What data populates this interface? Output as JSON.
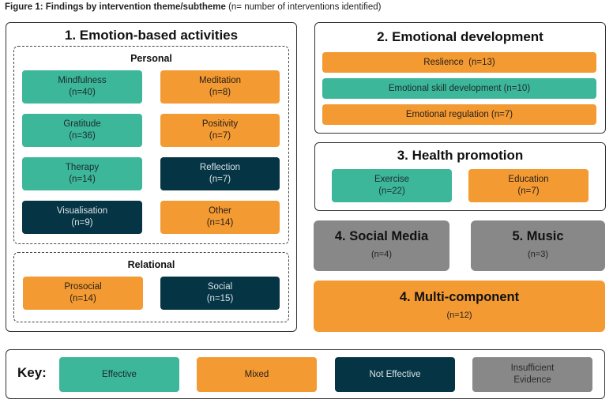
{
  "caption": {
    "bold": "Figure 1: Findings by intervention theme/subtheme",
    "normal": " (n= number of interventions identified)"
  },
  "colors": {
    "effective": "#3cb79a",
    "mixed": "#f39a33",
    "not_effective": "#053444",
    "insufficient": "#888888"
  },
  "theme1": {
    "title": "1. Emotion-based activities",
    "personal": {
      "title": "Personal",
      "items": [
        {
          "label": "Mindfulness",
          "n": "(n=40)",
          "status": "effective"
        },
        {
          "label": "Meditation",
          "n": "(n=8)",
          "status": "mixed"
        },
        {
          "label": "Gratitude",
          "n": "(n=36)",
          "status": "effective"
        },
        {
          "label": "Positivity",
          "n": "(n=7)",
          "status": "mixed"
        },
        {
          "label": "Therapy",
          "n": "(n=14)",
          "status": "effective"
        },
        {
          "label": "Reflection",
          "n": "(n=7)",
          "status": "not_effective"
        },
        {
          "label": "Visualisation",
          "n": "(n=9)",
          "status": "not_effective"
        },
        {
          "label": "Other",
          "n": "(n=14)",
          "status": "mixed"
        }
      ]
    },
    "relational": {
      "title": "Relational",
      "items": [
        {
          "label": "Prosocial",
          "n": "(n=14)",
          "status": "mixed"
        },
        {
          "label": "Social",
          "n": "(n=15)",
          "status": "not_effective"
        }
      ]
    }
  },
  "theme2": {
    "title": "2. Emotional development",
    "items": [
      {
        "label": "Reslience  (n=13)",
        "status": "mixed"
      },
      {
        "label": "Emotional skill development (n=10)",
        "status": "effective"
      },
      {
        "label": "Emotional regulation (n=7)",
        "status": "mixed"
      }
    ]
  },
  "theme3": {
    "title": "3. Health promotion",
    "items": [
      {
        "label": "Exercise",
        "n": "(n=22)",
        "status": "effective"
      },
      {
        "label": "Education",
        "n": "(n=7)",
        "status": "mixed"
      }
    ]
  },
  "theme4": {
    "title": "4. Social Media",
    "n": "(n=4)",
    "status": "insufficient"
  },
  "theme5": {
    "title": "5. Music",
    "n": "(n=3)",
    "status": "insufficient"
  },
  "theme6": {
    "title": "4. Multi-component",
    "n": "(n=12)",
    "status": "mixed"
  },
  "key": {
    "label": "Key:",
    "items": [
      {
        "label": "Effective",
        "status": "effective"
      },
      {
        "label": "Mixed",
        "status": "mixed"
      },
      {
        "label": "Not Effective",
        "status": "not_effective"
      },
      {
        "label": "Insufficient",
        "label2": "Evidence",
        "status": "insufficient"
      }
    ]
  }
}
